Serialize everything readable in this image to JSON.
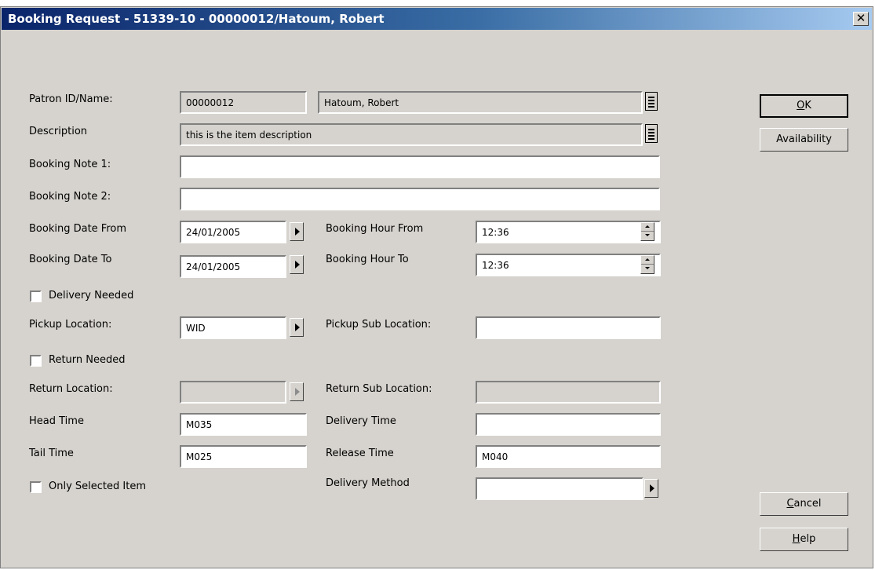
{
  "window": {
    "title": "Booking Request - 51339-10 - 00000012/Hatoum, Robert",
    "close": "✕"
  },
  "labels": {
    "patron": "Patron ID/Name:",
    "description": "Description",
    "note1": "Booking Note 1:",
    "note2": "Booking Note 2:",
    "date_from": "Booking Date From",
    "date_to": "Booking Date To",
    "hour_from": "Booking Hour From",
    "hour_to": "Booking Hour To",
    "delivery_needed": "Delivery Needed",
    "pickup_location": "Pickup Location:",
    "pickup_sub": "Pickup Sub Location:",
    "return_needed": "Return Needed",
    "return_location": "Return Location:",
    "return_sub": "Return Sub Location:",
    "head_time": "Head Time",
    "delivery_time": "Delivery Time",
    "tail_time": "Tail Time",
    "release_time": "Release Time",
    "only_selected": "Only Selected Item",
    "delivery_method": "Delivery Method"
  },
  "values": {
    "patron_id": "00000012",
    "patron_name": "Hatoum, Robert",
    "description": "this is the item description",
    "note1": "",
    "note2": "",
    "date_from": "24/01/2005",
    "date_to": "24/01/2005",
    "hour_from": "12:36",
    "hour_to": "12:36",
    "pickup_location": "WID",
    "pickup_sub": "",
    "return_location": "",
    "return_sub": "",
    "head_time": "M035",
    "delivery_time": "",
    "tail_time": "M025",
    "release_time": "M040",
    "delivery_method": ""
  },
  "checkboxes": {
    "delivery_needed": false,
    "return_needed": false,
    "only_selected": false
  },
  "buttons": {
    "ok_key": "O",
    "ok_rest": "K",
    "availability": "Availability",
    "cancel_key": "C",
    "cancel_rest": "ancel",
    "help_key": "H",
    "help_rest": "elp"
  }
}
